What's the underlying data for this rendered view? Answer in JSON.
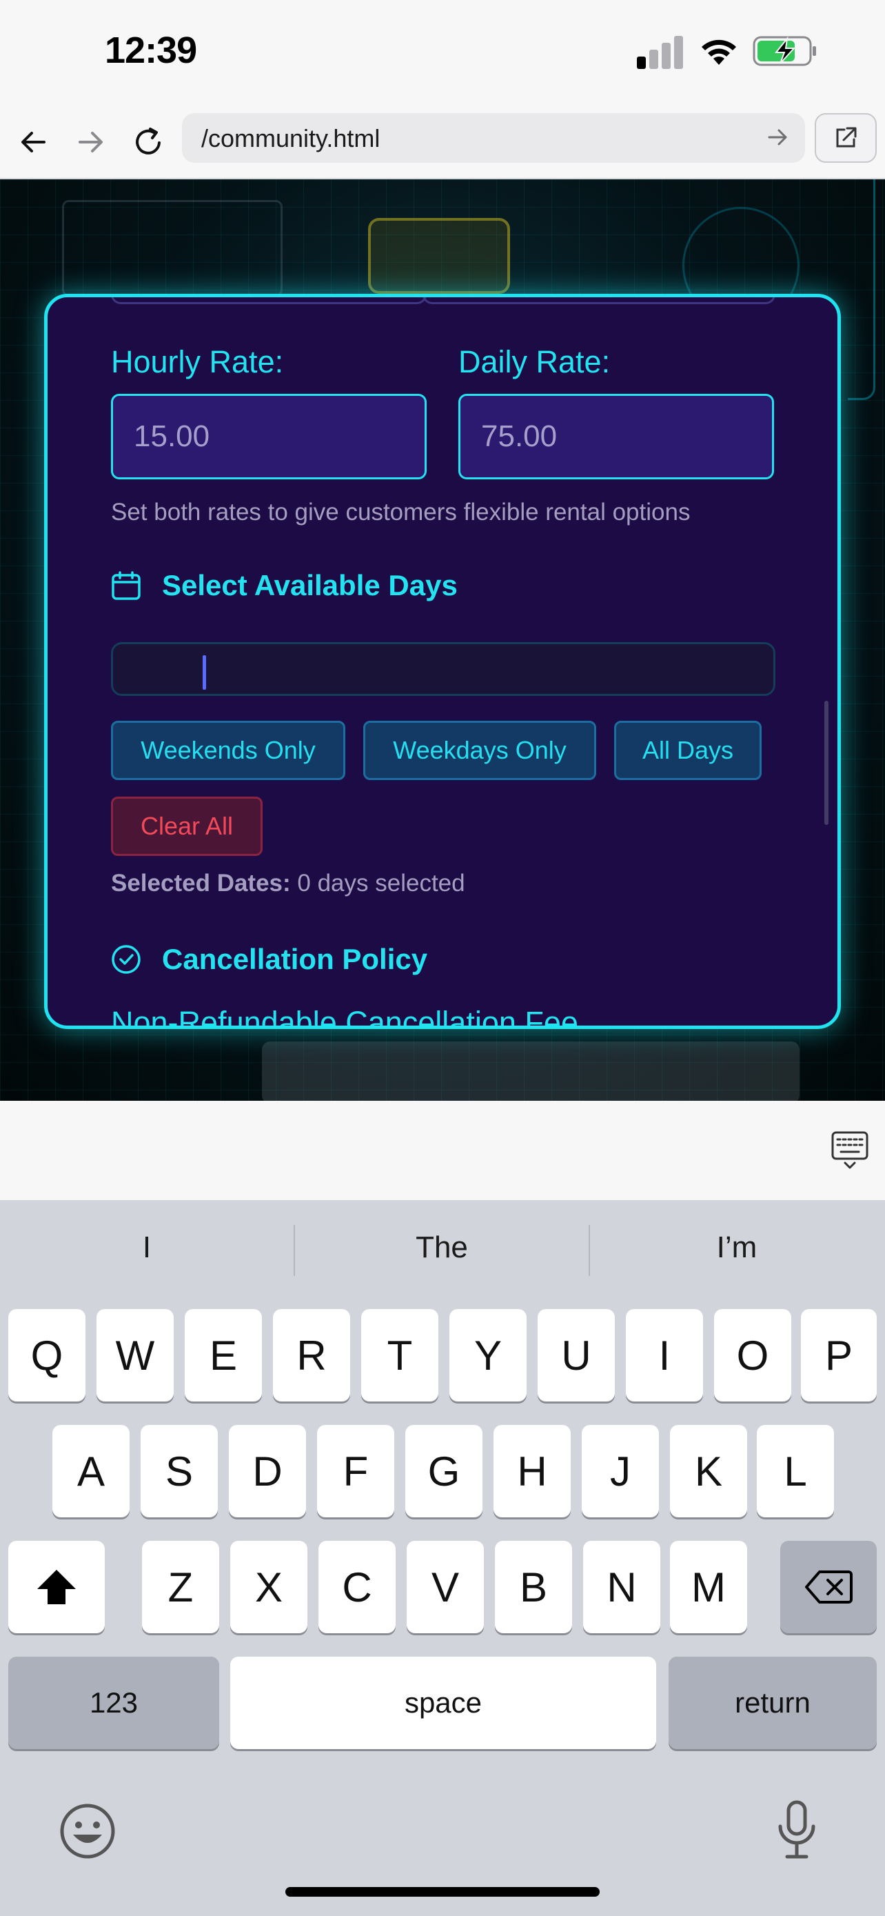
{
  "status_bar": {
    "time": "12:39"
  },
  "browser": {
    "url": "/community.html"
  },
  "form": {
    "hourly_label": "Hourly Rate:",
    "hourly_placeholder": "15.00",
    "daily_label": "Daily Rate:",
    "daily_placeholder": "75.00",
    "hint": "Set both rates to give customers flexible rental options",
    "days_title": "Select Available Days",
    "buttons": [
      "Weekends Only",
      "Weekdays Only",
      "All Days"
    ],
    "clear_label": "Clear All",
    "selected_label": "Selected Dates:",
    "selected_value": "0 days selected",
    "cancel_title": "Cancellation Policy",
    "fee_label": "Non-Refundable Cancellation Fee"
  },
  "keyboard": {
    "suggestions": [
      "I",
      "The",
      "I’m"
    ],
    "row1": [
      "Q",
      "W",
      "E",
      "R",
      "T",
      "Y",
      "U",
      "I",
      "O",
      "P"
    ],
    "row2": [
      "A",
      "S",
      "D",
      "F",
      "G",
      "H",
      "J",
      "K",
      "L"
    ],
    "row3": [
      "Z",
      "X",
      "C",
      "V",
      "B",
      "N",
      "M"
    ],
    "numbers_label": "123",
    "space_label": "space",
    "return_label": "return"
  },
  "colors": {
    "accent": "#22e3ef",
    "card_bg": "#1d0b45",
    "danger": "#f24a58"
  }
}
